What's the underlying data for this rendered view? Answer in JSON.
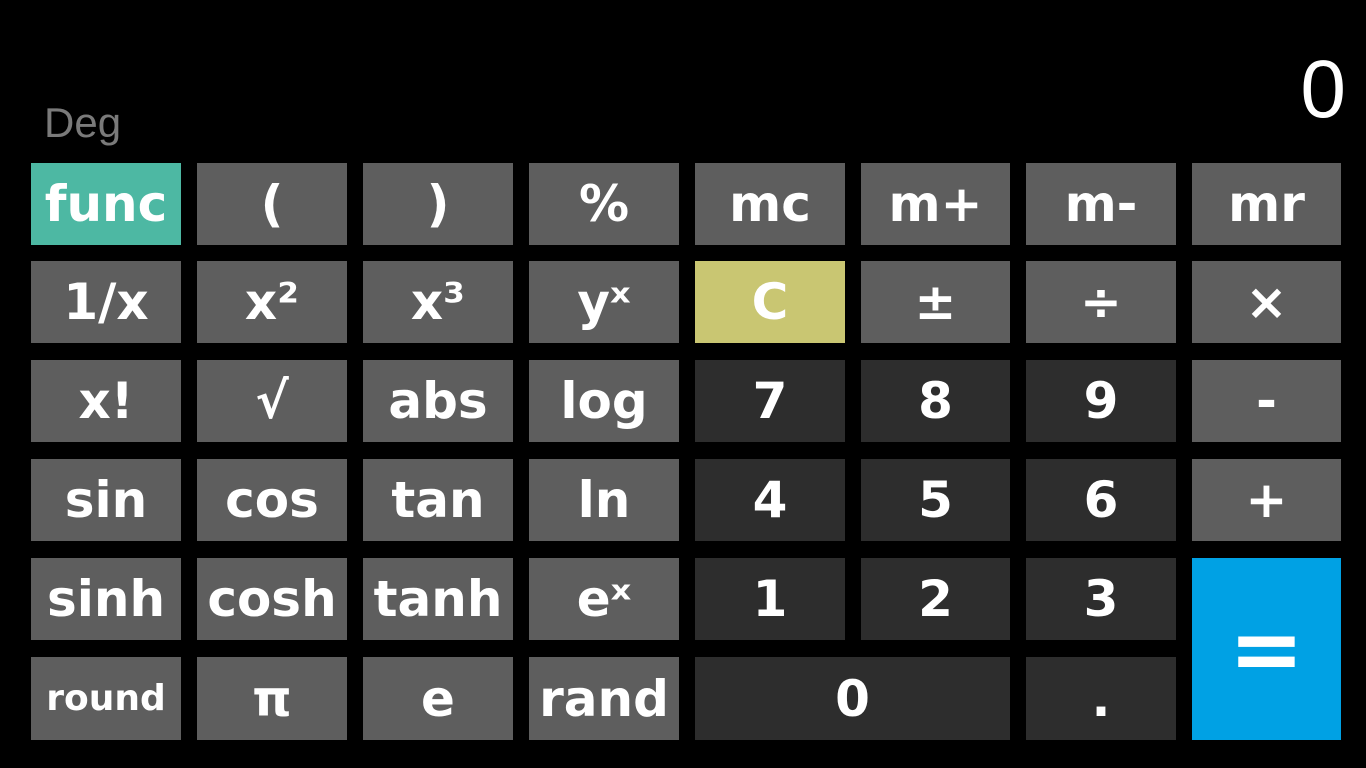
{
  "mode": "Deg",
  "display": "0",
  "colors": {
    "background": "#000000",
    "function_key": "#5e5e5e",
    "number_key": "#2d2d2d",
    "func_toggle": "#4db8a3",
    "clear_key": "#c9c672",
    "equals_key": "#00a1e4",
    "mode_text": "#7a7a7a"
  },
  "keys": {
    "func": "func",
    "open_paren": "(",
    "close_paren": ")",
    "percent": "%",
    "mc": "mc",
    "m_plus": "m+",
    "m_minus": "m-",
    "mr": "mr",
    "reciprocal": "1/x",
    "square": "x²",
    "cube": "x³",
    "power": "yˣ",
    "clear": "C",
    "plus_minus": "±",
    "divide": "÷",
    "multiply": "×",
    "factorial": "x!",
    "sqrt": "√",
    "abs": "abs",
    "log": "log",
    "seven": "7",
    "eight": "8",
    "nine": "9",
    "subtract": "-",
    "sin": "sin",
    "cos": "cos",
    "tan": "tan",
    "ln": "ln",
    "four": "4",
    "five": "5",
    "six": "6",
    "add": "+",
    "sinh": "sinh",
    "cosh": "cosh",
    "tanh": "tanh",
    "exp": "eˣ",
    "one": "1",
    "two": "2",
    "three": "3",
    "equals": "=",
    "round": "round",
    "pi": "π",
    "e": "e",
    "rand": "rand",
    "zero": "0",
    "decimal": "."
  }
}
